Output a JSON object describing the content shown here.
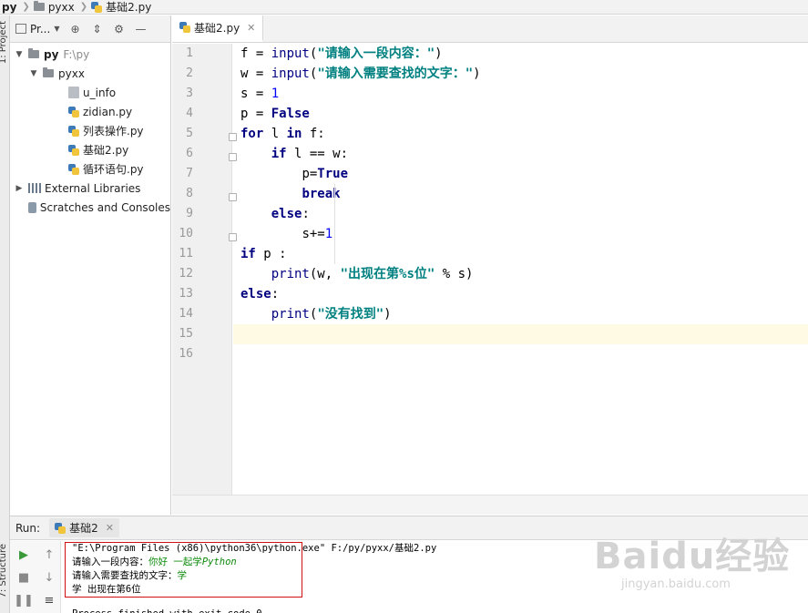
{
  "breadcrumb": {
    "items": [
      "py",
      "pyxx",
      "基础2.py"
    ]
  },
  "tool_stripe": {
    "project_tab": "1: Project",
    "structure_tab": "7: Structure"
  },
  "project_panel": {
    "dropdown_label": "Pr...",
    "tree": [
      {
        "label": "py",
        "detail": "F:\\py",
        "type": "folder",
        "expanded": true
      },
      {
        "label": "pyxx",
        "type": "folder",
        "expanded": true
      },
      {
        "label": "u_info",
        "type": "file"
      },
      {
        "label": "zidian.py",
        "type": "python"
      },
      {
        "label": "列表操作.py",
        "type": "python"
      },
      {
        "label": "基础2.py",
        "type": "python"
      },
      {
        "label": "循环语句.py",
        "type": "python"
      },
      {
        "label": "External Libraries",
        "type": "library"
      },
      {
        "label": "Scratches and Consoles",
        "type": "scratch"
      }
    ]
  },
  "editor": {
    "tab_label": "基础2.py",
    "line_numbers": [
      "1",
      "2",
      "3",
      "4",
      "5",
      "6",
      "7",
      "8",
      "9",
      "10",
      "11",
      "12",
      "13",
      "14",
      "15",
      "16"
    ]
  },
  "code": {
    "l1_a": "f = ",
    "l1_fn": "input",
    "l1_b": "(",
    "l1_str": "\"请输入一段内容：\"",
    "l1_c": ")",
    "l2_a": "w = ",
    "l2_fn": "input",
    "l2_b": "(",
    "l2_str": "\"请输入需要查找的文字：\"",
    "l2_c": ")",
    "l3_a": "s = ",
    "l3_num": "1",
    "l4_a": "p = ",
    "l4_kw": "False",
    "l5_kw1": "for",
    "l5_a": " l ",
    "l5_kw2": "in",
    "l5_b": " f:",
    "l6_ind": "    ",
    "l6_kw": "if",
    "l6_a": " l == w:",
    "l7_ind": "        ",
    "l7_a": "p=",
    "l7_kw": "True",
    "l8_ind": "        ",
    "l8_kw": "break",
    "l9_ind": "    ",
    "l9_kw": "else",
    "l9_a": ":",
    "l10_ind": "        ",
    "l10_a": "s+=",
    "l10_num": "1",
    "l11_kw": "if",
    "l11_a": " p :",
    "l12_ind": "    ",
    "l12_fn": "print",
    "l12_a": "(w, ",
    "l12_str": "\"出现在第%s位\"",
    "l12_b": " % s)",
    "l13_kw": "else",
    "l13_a": ":",
    "l14_ind": "    ",
    "l14_fn": "print",
    "l14_a": "(",
    "l14_str": "\"没有找到\"",
    "l14_b": ")"
  },
  "run_panel": {
    "label": "Run:",
    "tab_label": "基础2",
    "console": {
      "command": "\"E:\\Program Files (x86)\\python36\\python.exe\" F:/py/pyxx/基础2.py",
      "prompt1": "请输入一段内容：",
      "input1_a": "你好 一起学",
      "input1_b": "Python",
      "prompt2": "请输入需要查找的文字：",
      "input2": "学",
      "result": "学 出现在第6位",
      "exit_line": "Process finished with exit code 0"
    }
  },
  "watermark": {
    "logo": "Baidu经验",
    "site": "jingyan.baidu.com"
  },
  "colors": {
    "keyword": "#000080",
    "string": "#008080",
    "number": "#0000ff",
    "user_input": "#0b8a0b",
    "highlight_box": "#d01010"
  }
}
